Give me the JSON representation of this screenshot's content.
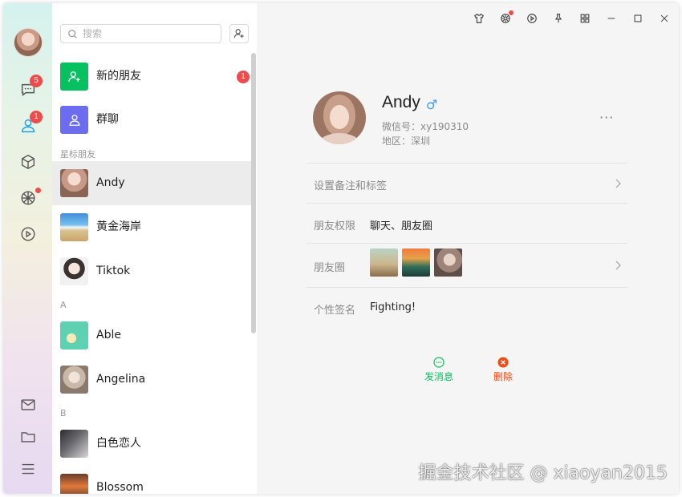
{
  "sidebar": {
    "chat_badge": "5",
    "contacts_badge": "1",
    "icons": [
      "chat-icon",
      "contacts-icon",
      "cube-icon",
      "moments-icon",
      "play-icon",
      "mail-icon",
      "folder-icon",
      "menu-icon"
    ]
  },
  "contact_list": {
    "search_placeholder": "搜索",
    "new_friends": {
      "label": "新的朋友",
      "count": "1"
    },
    "group_chat": {
      "label": "群聊"
    },
    "section_starred": "星标朋友",
    "starred": [
      {
        "name": "Andy",
        "selected": true
      },
      {
        "name": "黄金海岸"
      },
      {
        "name": "Tiktok"
      }
    ],
    "section_a": "A",
    "group_a": [
      {
        "name": "Able"
      },
      {
        "name": "Angelina"
      }
    ],
    "section_b": "B",
    "group_b": [
      {
        "name": "白色恋人"
      },
      {
        "name": "Blossom"
      }
    ]
  },
  "profile": {
    "name": "Andy",
    "gender_symbol": "♂",
    "wechat_id_label": "微信号：",
    "wechat_id": "xy190310",
    "region_label": "地区：",
    "region": "深圳",
    "more": "···",
    "rows": {
      "remark": {
        "label": "设置备注和标签"
      },
      "permission": {
        "label": "朋友权限",
        "value": "聊天、朋友圈"
      },
      "moments": {
        "label": "朋友圈"
      },
      "signature": {
        "label": "个性签名",
        "value": "Fighting!"
      }
    },
    "actions": {
      "message": "发消息",
      "delete": "删除"
    }
  },
  "colors": {
    "accent_green": "#07c160",
    "delete_red": "#f04b16",
    "badge_red": "#f04b4b",
    "group_purple": "#6c6cf0"
  },
  "watermark": "掘金技术社区 @ xiaoyan2015"
}
